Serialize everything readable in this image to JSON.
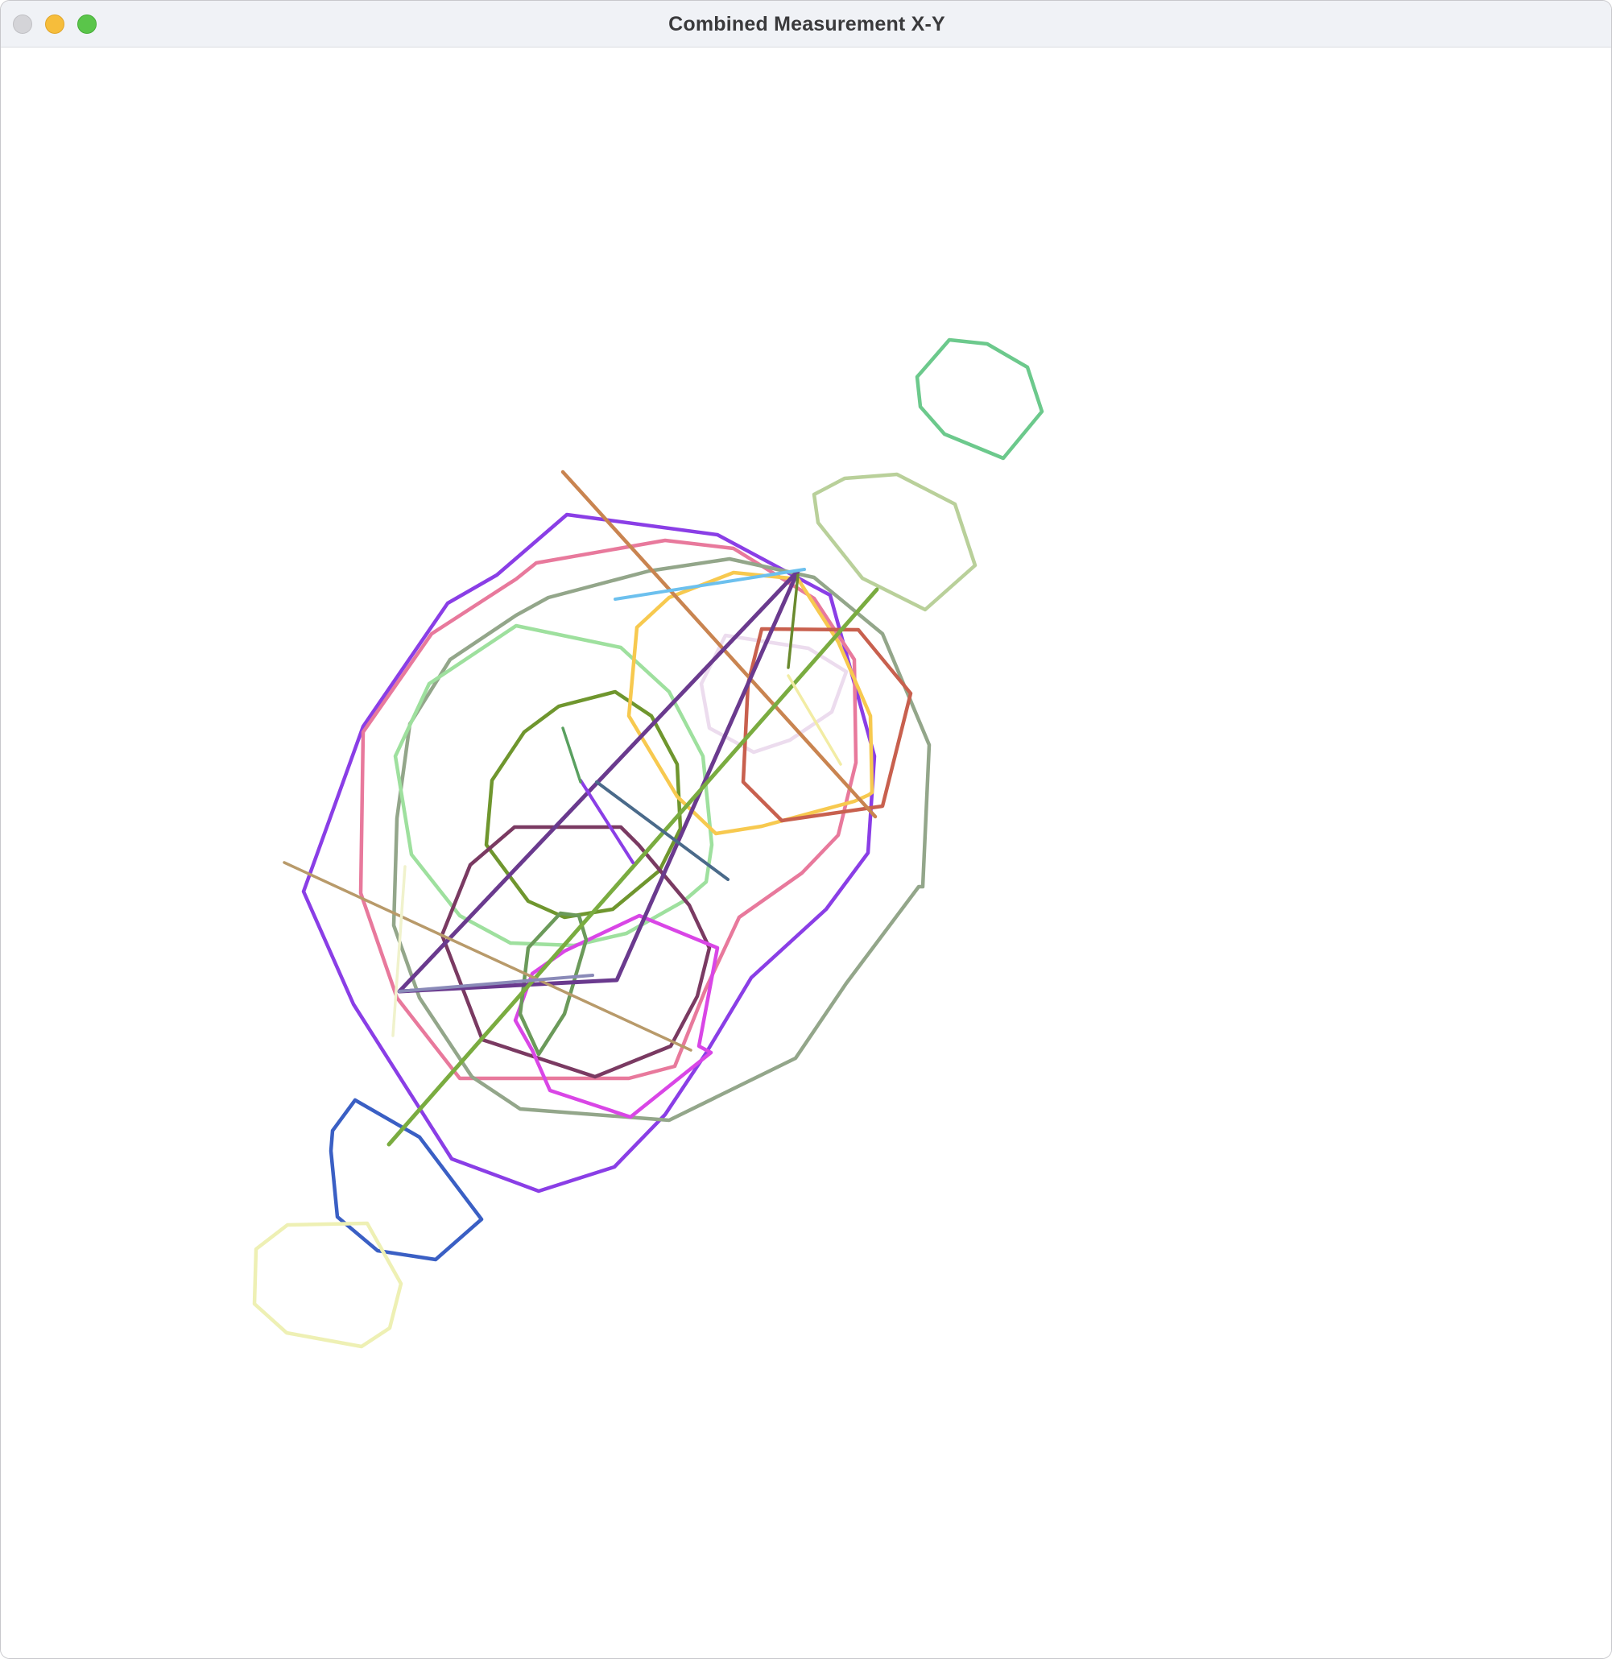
{
  "window": {
    "title": "Combined Measurement X-Y",
    "controls": {
      "close": "close-button",
      "minimize": "minimize-button",
      "zoom": "zoom-button"
    }
  },
  "canvas": {
    "background": "#ffffff",
    "shapes": [
      {
        "name": "purple-polygon",
        "color": "#8a3ee6",
        "closed": true
      },
      {
        "name": "pink-polygon",
        "color": "#e8799c",
        "closed": true
      },
      {
        "name": "gray-green-polygon",
        "color": "#93a68a",
        "closed": true
      },
      {
        "name": "light-green-polygon",
        "color": "#9ee09e",
        "closed": true
      },
      {
        "name": "olive-polygon",
        "color": "#6f962e",
        "closed": true
      },
      {
        "name": "yellow-polygon",
        "color": "#f7c94f",
        "closed": true
      },
      {
        "name": "lavender-polygon",
        "color": "#ecdcee",
        "closed": true
      },
      {
        "name": "red-polygon",
        "color": "#c8604e",
        "closed": true
      },
      {
        "name": "maroon-polygon",
        "color": "#7a3a62",
        "closed": true
      },
      {
        "name": "magenta-polygon",
        "color": "#d946e6",
        "closed": true
      },
      {
        "name": "small-green-polygon",
        "color": "#6b9a5a",
        "closed": true
      },
      {
        "name": "teal-green-polygon",
        "color": "#6cc98c",
        "closed": true
      },
      {
        "name": "sage-polygon",
        "color": "#b9d09a",
        "closed": true
      },
      {
        "name": "blue-polygon",
        "color": "#3a5fc4",
        "closed": true
      },
      {
        "name": "pale-yellow-polygon",
        "color": "#eef0b4",
        "closed": true
      },
      {
        "name": "orange-brown-line",
        "color": "#c98450",
        "closed": false
      },
      {
        "name": "dark-purple-triangle",
        "color": "#6a3a8e",
        "closed": false
      },
      {
        "name": "green-diagonal-line",
        "color": "#7aac40",
        "closed": false
      },
      {
        "name": "tan-line",
        "color": "#b89a6a",
        "closed": false
      },
      {
        "name": "sky-blue-line",
        "color": "#6cc0ee",
        "closed": false
      },
      {
        "name": "slate-blue-line",
        "color": "#4a6a8a",
        "closed": false
      },
      {
        "name": "violet-short-line",
        "color": "#8a3ee6",
        "closed": false
      },
      {
        "name": "green-short-line",
        "color": "#5aa060",
        "closed": false
      },
      {
        "name": "olive-short-line",
        "color": "#6a8a2e",
        "closed": false
      },
      {
        "name": "pale-yellow-line",
        "color": "#f2eca4",
        "closed": false
      },
      {
        "name": "pale-yellow-vertical",
        "color": "#f0f2cc",
        "closed": false
      },
      {
        "name": "periwinkle-line",
        "color": "#8a8ab8",
        "closed": false
      }
    ]
  }
}
